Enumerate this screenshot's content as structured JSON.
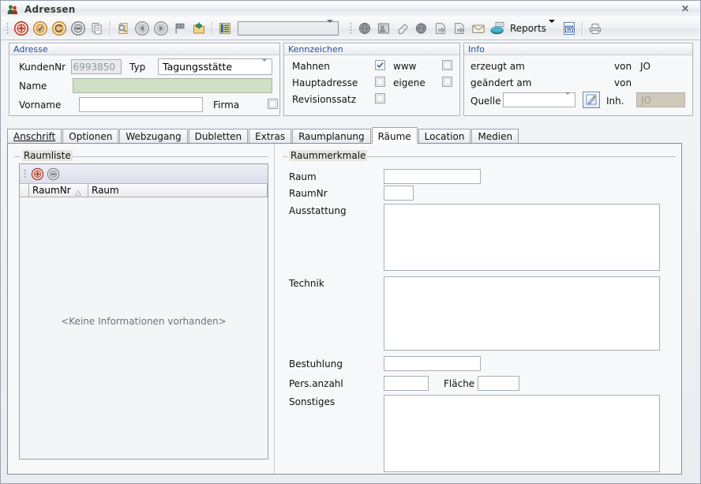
{
  "window": {
    "title": "Adressen",
    "close_label": "✕",
    "app_icon": "people-icon"
  },
  "toolbar": {
    "buttons": [
      {
        "name": "new-record-icon",
        "tip": "Neu"
      },
      {
        "name": "save-record-icon",
        "tip": "Speichern"
      },
      {
        "name": "refresh-record-icon",
        "tip": "Aktualisieren"
      },
      {
        "name": "delete-record-icon",
        "tip": "Löschen"
      },
      {
        "name": "copy-icon",
        "tip": "Kopieren"
      },
      {
        "name": "search-icon",
        "tip": "Suchen"
      },
      {
        "name": "back-arrow-icon",
        "tip": "Zurück"
      },
      {
        "name": "forward-arrow-icon",
        "tip": "Vor"
      },
      {
        "name": "flag-icon",
        "tip": "Markieren"
      },
      {
        "name": "export-folder-icon",
        "tip": "Export"
      },
      {
        "name": "list-view-icon",
        "tip": "Liste"
      }
    ],
    "combo_value": "",
    "right_buttons": [
      {
        "name": "globe-icon",
        "tip": "Web"
      },
      {
        "name": "contact-photo-icon",
        "tip": "Kontakt"
      },
      {
        "name": "eraser-icon",
        "tip": "Radierer"
      },
      {
        "name": "globe-pin-icon",
        "tip": "Karte"
      },
      {
        "name": "next-page-icon",
        "tip": "Weiter"
      },
      {
        "name": "next-page-2-icon",
        "tip": "Weiter"
      },
      {
        "name": "mail-icon",
        "tip": "E-Mail"
      },
      {
        "name": "printer-reports-icon",
        "tip": "Reports"
      }
    ],
    "reports_label": "Reports",
    "word_export": {
      "name": "word-export-icon",
      "glyph": "W"
    },
    "print_icon": "print-icon"
  },
  "adresse": {
    "title": "Adresse",
    "kundennr_label": "KundenNr",
    "kundennr_value": "6993850",
    "typ_label": "Typ",
    "typ_value": "Tagungsstätte",
    "name_label": "Name",
    "name_value": "",
    "vorname_label": "Vorname",
    "vorname_value": "",
    "firma_label": "Firma",
    "firma_checked": false
  },
  "kennzeichen": {
    "title": "Kennzeichen",
    "rows": [
      {
        "label": "Mahnen",
        "checked": true
      },
      {
        "label": "Hauptadresse",
        "checked": false
      },
      {
        "label": "Revisionssatz",
        "checked": false
      }
    ],
    "right_rows": [
      {
        "label": "www",
        "checked": false
      },
      {
        "label": "eigene",
        "checked": false
      }
    ]
  },
  "info": {
    "title": "Info",
    "erzeugt_label": "erzeugt am",
    "erzeugt_value": "",
    "erzeugt_von_label": "von",
    "erzeugt_von_value": "JO",
    "geaendert_label": "geändert am",
    "geaendert_value": "",
    "geaendert_von_label": "von",
    "geaendert_von_value": "",
    "quelle_label": "Quelle",
    "quelle_value": "",
    "edit_icon": "edit-pencil-icon",
    "inh_label": "Inh.",
    "inh_value": "JO"
  },
  "tabs": [
    {
      "label": "Anschrift",
      "accel": "A",
      "active": false
    },
    {
      "label": "Optionen",
      "accel": "",
      "active": false
    },
    {
      "label": "Webzugang",
      "accel": "",
      "active": false
    },
    {
      "label": "Dubletten",
      "accel": "b",
      "active": false
    },
    {
      "label": "Extras",
      "accel": "",
      "active": false
    },
    {
      "label": "Raumplanung",
      "accel": "",
      "active": false
    },
    {
      "label": "Räume",
      "accel": "",
      "active": true
    },
    {
      "label": "Location",
      "accel": "",
      "active": false
    },
    {
      "label": "Medien",
      "accel": "",
      "active": false
    }
  ],
  "raumliste": {
    "caption": "Raumliste",
    "add_icon": "add-room-icon",
    "remove_icon": "remove-room-icon",
    "columns": [
      "RaumNr",
      "Raum"
    ],
    "sort_column": "RaumNr",
    "sort_direction": "ascending",
    "rows": [],
    "empty_text": "<Keine Informationen vorhanden>"
  },
  "raummerkmale": {
    "caption": "Raummerkmale",
    "fields": [
      {
        "label": "Raum",
        "value": ""
      },
      {
        "label": "RaumNr",
        "value": ""
      },
      {
        "label": "Ausstattung",
        "value": ""
      },
      {
        "label": "Technik",
        "value": ""
      },
      {
        "label": "Bestuhlung",
        "value": ""
      },
      {
        "label": "Pers.anzahl",
        "value": ""
      },
      {
        "label": "Fläche",
        "value": ""
      },
      {
        "label": "Sonstiges",
        "value": ""
      }
    ]
  },
  "colors": {
    "panel_title": "#2a4d9b",
    "name_highlight": "#cfe0c6",
    "readonly_bg": "#e8e9ec",
    "inh_bg": "#cfc9bc",
    "window_bg": "#f4f6f8"
  }
}
